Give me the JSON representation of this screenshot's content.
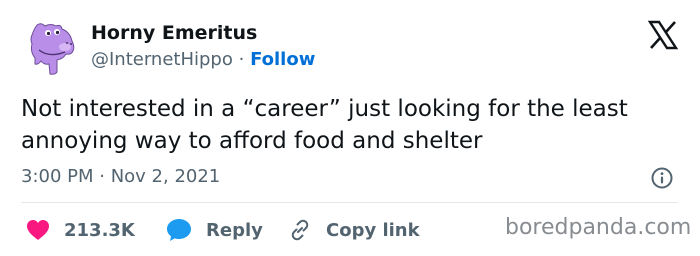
{
  "author": {
    "display_name": "Horny Emeritus",
    "handle": "@InternetHippo",
    "separator": "·",
    "follow_label": "Follow",
    "avatar_icon": "purple-hippo-avatar"
  },
  "tweet": {
    "text": "Not interested in a “career” just looking for the least annoying way to afford food and shelter",
    "timestamp": "3:00 PM · Nov 2, 2021"
  },
  "actions": {
    "likes": "213.3K",
    "reply_label": "Reply",
    "copy_link_label": "Copy link"
  },
  "watermark": "boredpanda.com",
  "colors": {
    "text": "#0f1419",
    "secondary": "#536471",
    "link": "#006fd6",
    "heart": "#f91880",
    "reply_bubble": "#1d9bf0",
    "avatar": "#b98ee8"
  },
  "icons": [
    "x-logo-icon",
    "info-icon",
    "heart-icon",
    "reply-icon",
    "link-icon"
  ]
}
